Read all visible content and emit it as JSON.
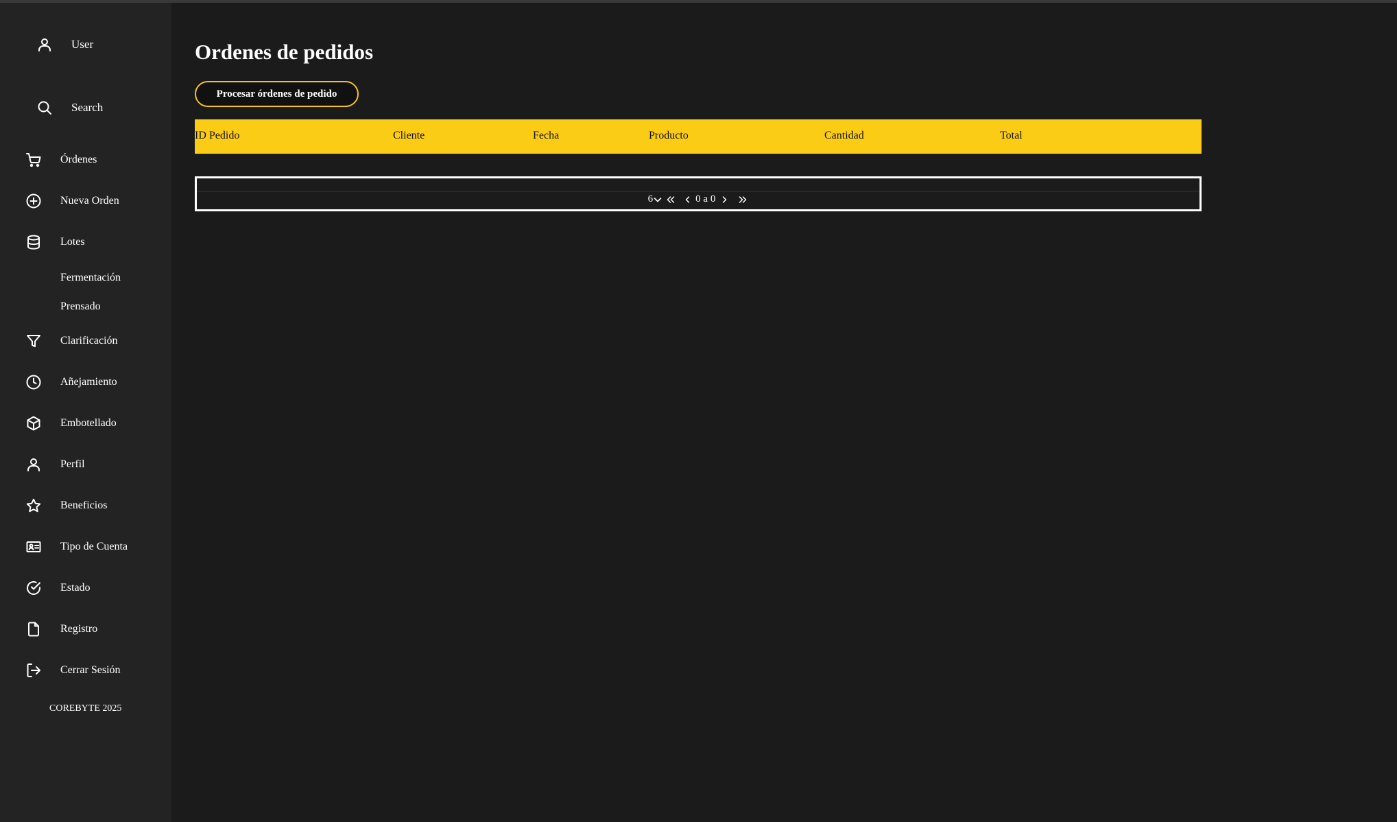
{
  "sidebar": {
    "user_label": "User",
    "search_label": "Search",
    "items": [
      {
        "label": "Órdenes",
        "icon": "cart-icon"
      },
      {
        "label": "Nueva Orden",
        "icon": "plus-circle-icon"
      },
      {
        "label": "Lotes",
        "icon": "database-icon"
      },
      {
        "label": "Fermentación"
      },
      {
        "label": "Prensado"
      },
      {
        "label": "Clarificación",
        "icon": "filter-icon"
      },
      {
        "label": "Añejamiento",
        "icon": "clock-icon"
      },
      {
        "label": "Embotellado",
        "icon": "box-icon"
      },
      {
        "label": "Perfil",
        "icon": "user-icon"
      },
      {
        "label": "Beneficios",
        "icon": "star-icon"
      },
      {
        "label": "Tipo de Cuenta",
        "icon": "id-card-icon"
      },
      {
        "label": "Estado",
        "icon": "check-circle-icon"
      },
      {
        "label": "Registro",
        "icon": "file-icon"
      },
      {
        "label": "Cerrar Sesión",
        "icon": "logout-icon"
      }
    ],
    "footer": "COREBYTE 2025"
  },
  "main": {
    "title": "Ordenes de pedidos",
    "process_button": "Procesar órdenes de pedido",
    "table": {
      "columns": [
        "ID Pedido",
        "Cliente",
        "Fecha",
        "Producto",
        "Cantidad",
        "Total"
      ],
      "rows": []
    },
    "pagination": {
      "page_size": "6",
      "range_text": "0 a 0"
    }
  },
  "colors": {
    "accent": "#fbcc15",
    "background": "#1b1b1b",
    "sidebar": "#232323"
  }
}
